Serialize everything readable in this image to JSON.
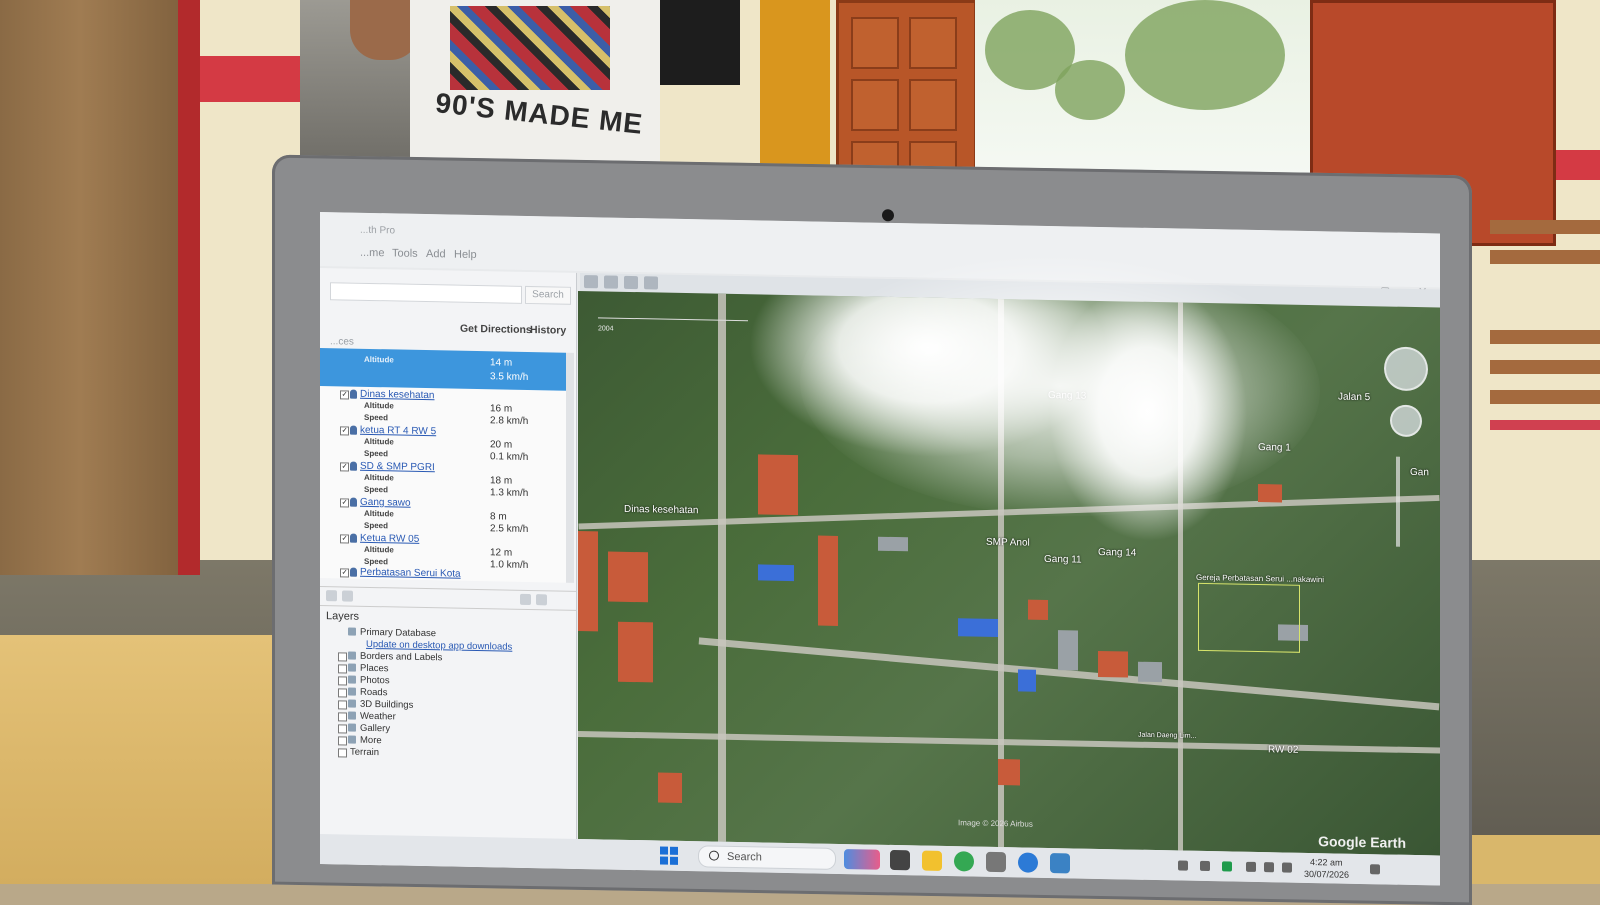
{
  "window": {
    "title": "...th Pro",
    "menu": [
      "...me",
      "Tools",
      "Add",
      "Help"
    ]
  },
  "search": {
    "button_label": "Search",
    "value": ""
  },
  "tabs": {
    "directions": "Get Directions",
    "history": "History"
  },
  "places": {
    "header": "...ces",
    "items": [
      {
        "name": "",
        "altitude_label": "Altitude",
        "altitude": "14 m",
        "speed_label": "",
        "speed": "3.5 km/h",
        "checked": true,
        "selected": true
      },
      {
        "name": "Dinas kesehatan",
        "altitude_label": "Altitude",
        "altitude": "16 m",
        "speed_label": "Speed",
        "speed": "2.8 km/h",
        "checked": true
      },
      {
        "name": "ketua RT 4 RW 5",
        "altitude_label": "Altitude",
        "altitude": "20 m",
        "speed_label": "Speed",
        "speed": "0.1 km/h",
        "checked": true
      },
      {
        "name": "SD & SMP PGRI",
        "altitude_label": "Altitude",
        "altitude": "18 m",
        "speed_label": "Speed",
        "speed": "1.3 km/h",
        "checked": true
      },
      {
        "name": "Gang sawo",
        "altitude_label": "Altitude",
        "altitude": "8 m",
        "speed_label": "Speed",
        "speed": "2.5 km/h",
        "checked": true
      },
      {
        "name": "Ketua RW 05",
        "altitude_label": "Altitude",
        "altitude": "12 m",
        "speed_label": "Speed",
        "speed": "1.0 km/h",
        "checked": true
      },
      {
        "name": "Perbatasan Serui Kota",
        "checked": true
      }
    ]
  },
  "layers": {
    "header": "Layers",
    "items": [
      {
        "label": "Primary Database",
        "link": false
      },
      {
        "label": "Update on desktop app downloads",
        "link": true
      },
      {
        "label": "Borders and Labels",
        "link": false
      },
      {
        "label": "Places",
        "link": false
      },
      {
        "label": "Photos",
        "link": false
      },
      {
        "label": "Roads",
        "link": false
      },
      {
        "label": "3D Buildings",
        "link": false
      },
      {
        "label": "Weather",
        "link": false
      },
      {
        "label": "Gallery",
        "link": false
      },
      {
        "label": "More",
        "link": false
      },
      {
        "label": "Terrain",
        "link": false
      }
    ]
  },
  "map": {
    "labels": {
      "dinas": "Dinas kesehatan",
      "smp": "SMP Anol",
      "gang13": "Gang 13",
      "gang14": "Gang 14",
      "gang11": "Gang 11",
      "jalan": "Jalan 5",
      "gan": "Gan",
      "gang": "Gang 1",
      "rw02": "RW 02",
      "perbatasan": "Gereja Perbatasan Serui ...nakawini",
      "jalan_daeng": "Jalan Daeng Lim..."
    },
    "timeslider": {
      "year": "2004"
    },
    "attribution": "Image © 2026 Airbus",
    "brand": "Google Earth"
  },
  "taskbar": {
    "search_label": "Search",
    "time": "4:22 am",
    "date": "30/07/2026"
  },
  "photo": {
    "shirt_text": "90'S MADE ME"
  },
  "colors": {
    "selection": "#3d96dd",
    "link": "#2a5ab4",
    "windows_blue": "#1b6fd6"
  }
}
